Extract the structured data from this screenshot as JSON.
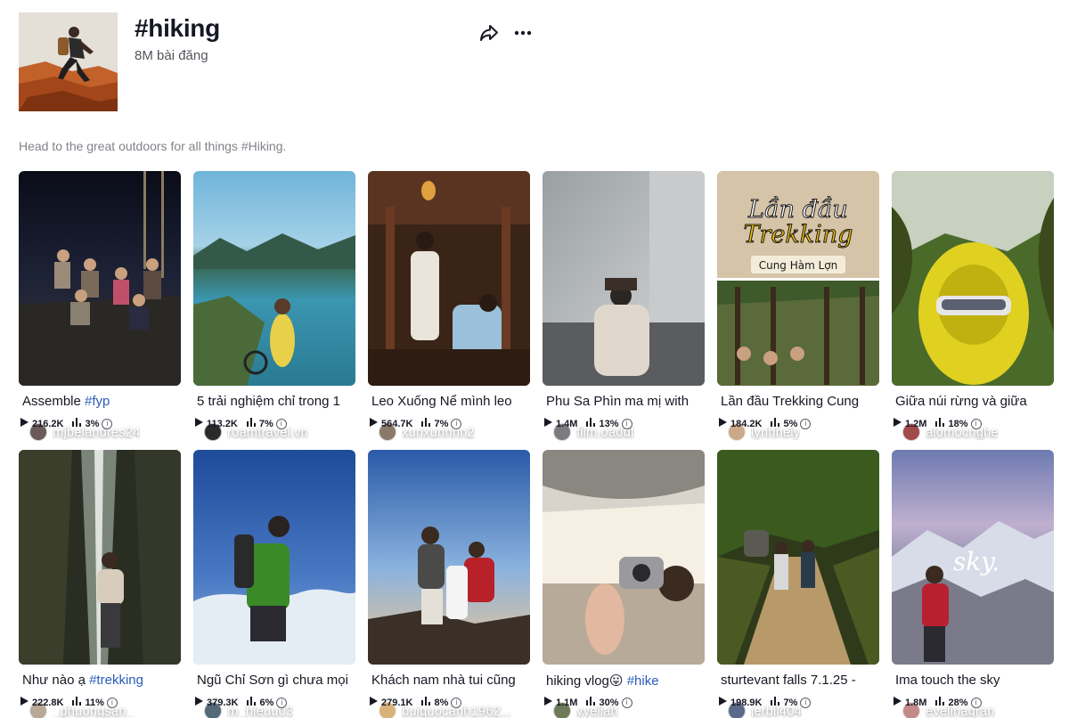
{
  "page": {
    "title": "#hiking",
    "post_count": "8M bài đăng",
    "description": "Head to the great outdoors for all things #Hiking.",
    "share_icon": "share-arrow-icon",
    "more_icon": "more-dots-icon"
  },
  "videos": [
    {
      "author": "mjbelandres24",
      "caption": "Assemble ",
      "tag": "#fyp",
      "views": "216.2K",
      "engagement": "3%",
      "avatar_color": "#6a5a58"
    },
    {
      "author": "roamtravel.vn",
      "caption": "5 trải nghiệm chỉ trong 1",
      "tag": "",
      "views": "113.2K",
      "engagement": "7%",
      "avatar_color": "#2a2a2a"
    },
    {
      "author": "xunxunnnn2",
      "caption": "Leo Xuống Nể mình leo",
      "tag": "",
      "views": "564.7K",
      "engagement": "7%",
      "avatar_color": "#8a7a6a"
    },
    {
      "author": "film.oaddf",
      "caption": "Phu Sa Phìn ma mị with",
      "tag": "",
      "views": "1.4M",
      "engagement": "13%",
      "avatar_color": "#7c7c80"
    },
    {
      "author": "lynhhely",
      "caption": "Lần đầu Trekking Cung",
      "tag": "",
      "views": "184.2K",
      "engagement": "5%",
      "avatar_color": "#c9a98a"
    },
    {
      "author": "alomocnghe",
      "caption": "Giữa núi rừng và giữa",
      "tag": "",
      "views": "1.2M",
      "engagement": "18%",
      "avatar_color": "#a04a4a"
    },
    {
      "author": "_phuongsan_",
      "caption": "Như nào ạ ",
      "tag": "#trekking",
      "views": "222.8K",
      "engagement": "11%",
      "avatar_color": "#b8a898"
    },
    {
      "author": "m_hieuu03",
      "caption": "Ngũ Chỉ Sơn gì chưa mọi",
      "tag": "",
      "views": "379.3K",
      "engagement": "6%",
      "avatar_color": "#556a78"
    },
    {
      "author": "buiquocanh1962...",
      "caption": "Khách nam nhà tui cũng",
      "tag": "",
      "views": "279.1K",
      "engagement": "8%",
      "avatar_color": "#d9b27a"
    },
    {
      "author": "yyeliah",
      "caption": "hiking vlog😛 ",
      "tag": "#hike",
      "views": "1.1M",
      "engagement": "30%",
      "avatar_color": "#6e7a5a"
    },
    {
      "author": "jerbil404",
      "caption": "sturtevant falls 7.1.25 -",
      "tag": "",
      "views": "198.9K",
      "engagement": "7%",
      "avatar_color": "#5a6a8a"
    },
    {
      "author": "evelinagran",
      "caption": "Ima touch the sky",
      "tag": "",
      "views": "1.8M",
      "engagement": "28%",
      "avatar_color": "#c48a8a"
    }
  ]
}
